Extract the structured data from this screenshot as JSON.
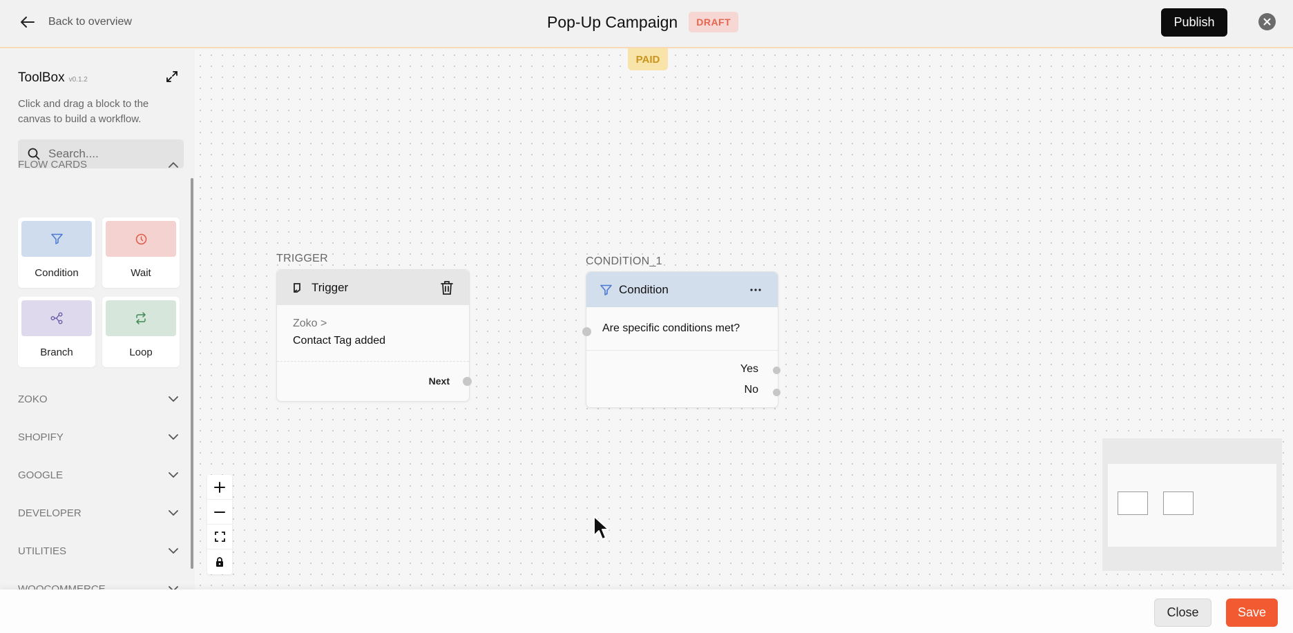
{
  "header": {
    "back_label": "Back to overview",
    "title": "Pop-Up Campaign",
    "status_badge": "DRAFT",
    "publish_label": "Publish"
  },
  "plan_badge": "PAID",
  "toolbox": {
    "title": "ToolBox",
    "version": "v0.1.2",
    "description": "Click and drag a block to the canvas to build a workflow.",
    "search_placeholder": "Search....",
    "flow_cards_header": "FLOW CARDS",
    "cards": [
      {
        "label": "Condition",
        "icon": "filter-icon",
        "color": "#cfdcee"
      },
      {
        "label": "Wait",
        "icon": "clock-icon",
        "color": "#f3d2d0"
      },
      {
        "label": "Branch",
        "icon": "branch-icon",
        "color": "#ded9ec"
      },
      {
        "label": "Loop",
        "icon": "loop-icon",
        "color": "#d6e6da"
      }
    ],
    "sections": [
      "ZOKO",
      "SHOPIFY",
      "GOOGLE",
      "DEVELOPER",
      "UTILITIES",
      "WOOCOMMERCE"
    ]
  },
  "trigger_node": {
    "tag": "TRIGGER",
    "title": "Trigger",
    "source": "Zoko >",
    "event": "Contact Tag added",
    "next_label": "Next"
  },
  "condition_node": {
    "tag": "CONDITION_1",
    "title": "Condition",
    "question": "Are specific conditions met?",
    "yes_label": "Yes",
    "no_label": "No",
    "header_color": "#d3deed"
  },
  "footer": {
    "close_label": "Close",
    "save_label": "Save"
  },
  "colors": {
    "accent_save": "#f25a32",
    "draft_badge": "#e5664f",
    "paid_badge": "#c9951e"
  }
}
